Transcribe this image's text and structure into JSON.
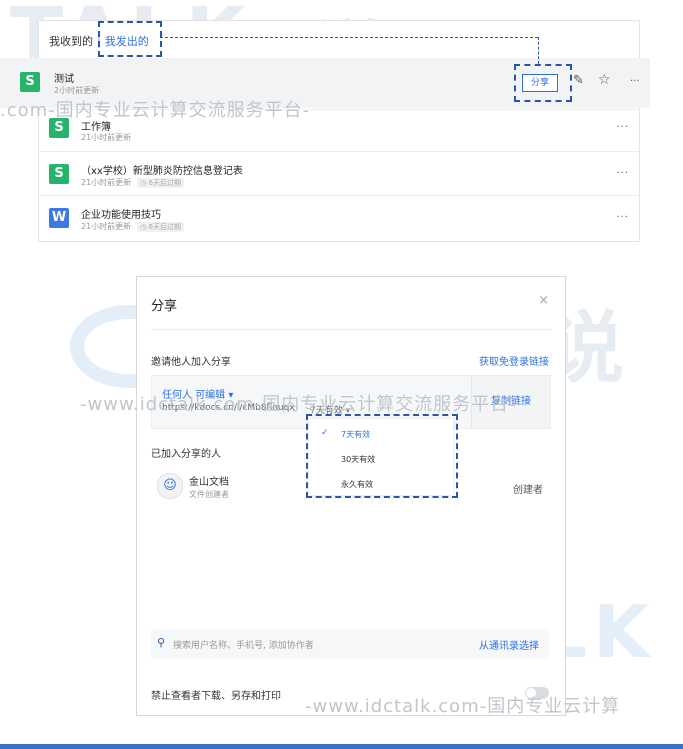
{
  "colors": {
    "accent": "#2f6fe6",
    "sheet_icon": "#26b36b",
    "word_icon": "#3c79e6",
    "annotation": "#2b55a8"
  },
  "watermark": {
    "brand_latin": "TALK",
    "brand_cn": "云说",
    "sub_top": ".com-国内专业云计算交流服务平台-",
    "sub_mid": "-www.idctalk.com-国内专业云计算交流服务平台-",
    "sub_bottom": "-www.idctalk.com-国内专业云计算"
  },
  "docs_panel": {
    "tabs": {
      "received": "我收到的",
      "separator": "|",
      "sent": "我发出的"
    },
    "highlighted": {
      "icon_letter": "S",
      "title": "测试",
      "meta": "2小时前更新",
      "share_button": "分享"
    },
    "rows": [
      {
        "icon_letter": "S",
        "icon_color": "#26b36b",
        "title": "工作簿",
        "meta": "21小时前更新",
        "expire": ""
      },
      {
        "icon_letter": "S",
        "icon_color": "#26b36b",
        "title": "（xx学校）新型肺炎防控信息登记表",
        "meta": "21小时前更新",
        "expire": "6天后过期"
      },
      {
        "icon_letter": "W",
        "icon_color": "#3c79e6",
        "title": "企业功能使用技巧",
        "meta": "21小时前更新",
        "expire": "6天后过期"
      }
    ],
    "more_icon": "···"
  },
  "dialog": {
    "title": "分享",
    "close_icon": "×",
    "invite_label": "邀请他人加入分享",
    "login_free_link": "获取免登录链接",
    "permission": "任何人 可编辑",
    "link_url": "https://kdocs.cn/l/cMb8Rouqx",
    "validity_selected": "7天有效",
    "copy_link": "复制链接",
    "validity_options": [
      "7天有效",
      "30天有效",
      "永久有效"
    ],
    "joined_label": "已加入分享的人",
    "member": {
      "name": "金山文档",
      "role_sub": "文件创建者",
      "role": "创建者"
    },
    "search_placeholder": "搜索用户名称、手机号, 添加协作者",
    "contacts_link": "从通讯录选择",
    "forbid_download": "禁止查看者下载、另存和打印"
  }
}
